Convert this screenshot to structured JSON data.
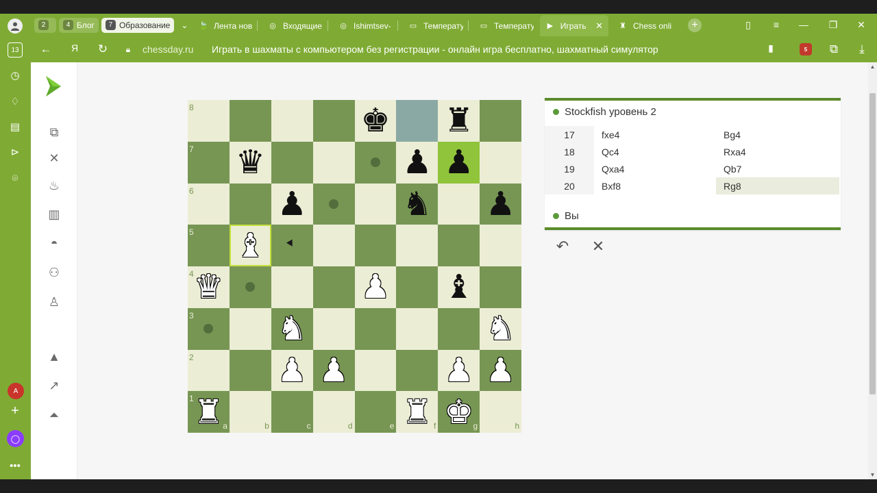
{
  "browser": {
    "tab_groups": [
      {
        "num": "2",
        "label": "",
        "active": false
      },
      {
        "num": "4",
        "label": "Блог",
        "active": false
      },
      {
        "num": "7",
        "label": "Образование",
        "active": true
      }
    ],
    "tabs": [
      {
        "label": "Лента нов",
        "icon": "yandex-icon"
      },
      {
        "label": "Входящие",
        "icon": "mail-icon"
      },
      {
        "label": "Ishimtsev-",
        "icon": "github-icon"
      },
      {
        "label": "Температу",
        "icon": "page-icon"
      },
      {
        "label": "Температу",
        "icon": "page-icon"
      },
      {
        "label": "Играть",
        "icon": "chessday-icon",
        "active": true
      },
      {
        "label": "Chess onli",
        "icon": "chess-rook-icon"
      }
    ],
    "new_tab": "+",
    "url_host": "chessday.ru",
    "page_title": "Играть в шахматы с компьютером без регистрации - онлайн игра бесплатно, шахматный симулятор",
    "rail_badge": "13",
    "ext_badge": "5"
  },
  "game": {
    "opponent": "Stockfish уровень 2",
    "player": "Вы",
    "moves": [
      {
        "num": "17",
        "white": "fxe4",
        "black": "Bg4"
      },
      {
        "num": "18",
        "white": "Qc4",
        "black": "Rxa4"
      },
      {
        "num": "19",
        "white": "Qxa4",
        "black": "Qb7"
      },
      {
        "num": "20",
        "white": "Bxf8",
        "black": "Rg8"
      }
    ],
    "board": [
      [
        "",
        "",
        "",
        "",
        "bk",
        "",
        "br",
        ""
      ],
      [
        "",
        "bq",
        "",
        "",
        "",
        "bp",
        "bp",
        ""
      ],
      [
        "",
        "",
        "bp",
        "",
        "",
        "bn",
        "",
        "bp"
      ],
      [
        "",
        "wb",
        "",
        "",
        "",
        "",
        "",
        ""
      ],
      [
        "wq",
        "",
        "",
        "",
        "wp",
        "",
        "bb",
        ""
      ],
      [
        "",
        "",
        "wn",
        "",
        "",
        "",
        "",
        "wn"
      ],
      [
        "",
        "",
        "wp",
        "wp",
        "",
        "",
        "wp",
        "wp"
      ],
      [
        "wr",
        "",
        "",
        "",
        "",
        "wr",
        "wk",
        ""
      ]
    ],
    "ranks": [
      "8",
      "7",
      "6",
      "5",
      "4",
      "3",
      "2",
      "1"
    ],
    "files": [
      "a",
      "b",
      "c",
      "d",
      "e",
      "f",
      "g",
      "h"
    ],
    "selected_square": "b5",
    "last_move_squares": [
      "f8",
      "g7"
    ],
    "legal_move_dots": [
      "e7",
      "d6",
      "b4",
      "a3"
    ],
    "colors": {
      "light": "#ecedd5",
      "dark": "#779654",
      "accent": "#7fab34"
    }
  }
}
